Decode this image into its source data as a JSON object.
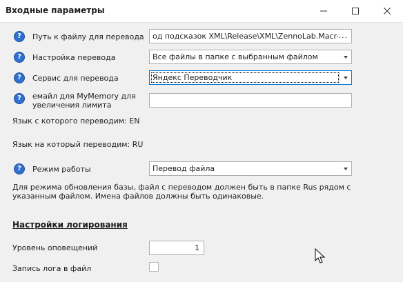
{
  "window": {
    "title": "Входные параметры"
  },
  "rows": [
    {
      "label": "Путь к файлу для перевода",
      "value": "од подсказок XML\\Release\\XML\\ZennoLab.Macros.xml",
      "action": "..."
    },
    {
      "label": "Настройка перевода",
      "value": "Все файлы в папке с выбранным файлом"
    },
    {
      "label": "Сервис для перевода",
      "value": "Яндекс Переводчик"
    },
    {
      "label": "емайл для MyMemory для увеличения лимита",
      "value": ""
    },
    {
      "label": "Режим работы",
      "value": "Перевод файла"
    }
  ],
  "lang_from": "Язык с которого переводим: EN",
  "lang_to": "Язык на который переводим: RU",
  "help_glyph": "?",
  "note": "Для режима обновления базы, файл с переводом должен быть в папке Rus рядом с указанным файлом. Имена файлов должны быть одинаковые.",
  "logging": {
    "section_title": "Настройки  логирования",
    "level_label": "Уровень оповещений",
    "level_value": "1",
    "file_label": "Запись лога в файл",
    "file_checked": false
  },
  "icons": [
    "help-icon",
    "minimize-icon",
    "maximize-icon",
    "close-icon",
    "dropdown-arrow-icon",
    "cursor-icon"
  ]
}
